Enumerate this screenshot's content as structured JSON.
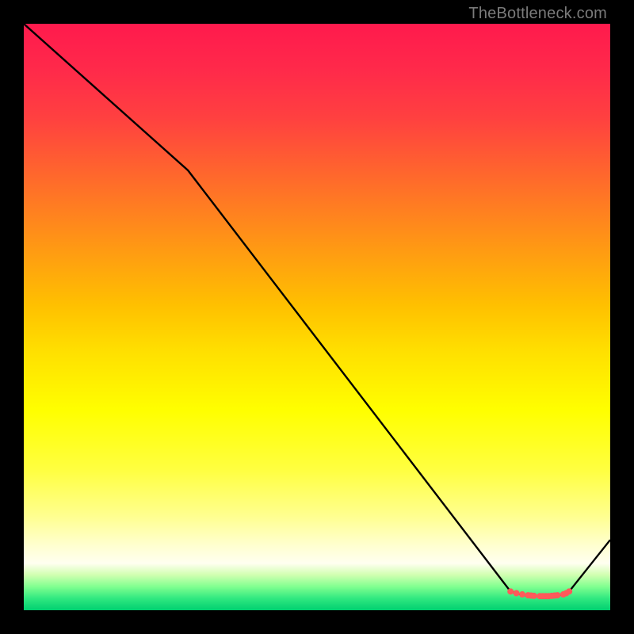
{
  "attribution": "TheBottleneck.com",
  "chart_data": {
    "type": "line",
    "title": "",
    "xlabel": "",
    "ylabel": "",
    "xlim": [
      0,
      100
    ],
    "ylim": [
      0,
      100
    ],
    "grid": false,
    "line_color": "#000000",
    "curve": {
      "name": "bottleneck-curve",
      "x": [
        0,
        28,
        83,
        85,
        86.5,
        88,
        89.5,
        91,
        92,
        93,
        100
      ],
      "y": [
        100,
        75,
        3.2,
        2.6,
        2.5,
        2.4,
        2.4,
        2.5,
        2.7,
        3.2,
        12
      ]
    },
    "markers": {
      "name": "optimal-range-dots",
      "color": "#ff5a5a",
      "size": 4,
      "x": [
        83,
        84,
        85,
        86,
        86.5,
        87,
        88,
        88.5,
        89,
        89.5,
        90,
        90.5,
        91,
        92,
        92.5,
        93
      ],
      "y": [
        3.2,
        2.9,
        2.7,
        2.55,
        2.5,
        2.45,
        2.4,
        2.4,
        2.4,
        2.4,
        2.45,
        2.5,
        2.55,
        2.7,
        2.9,
        3.2
      ]
    }
  }
}
